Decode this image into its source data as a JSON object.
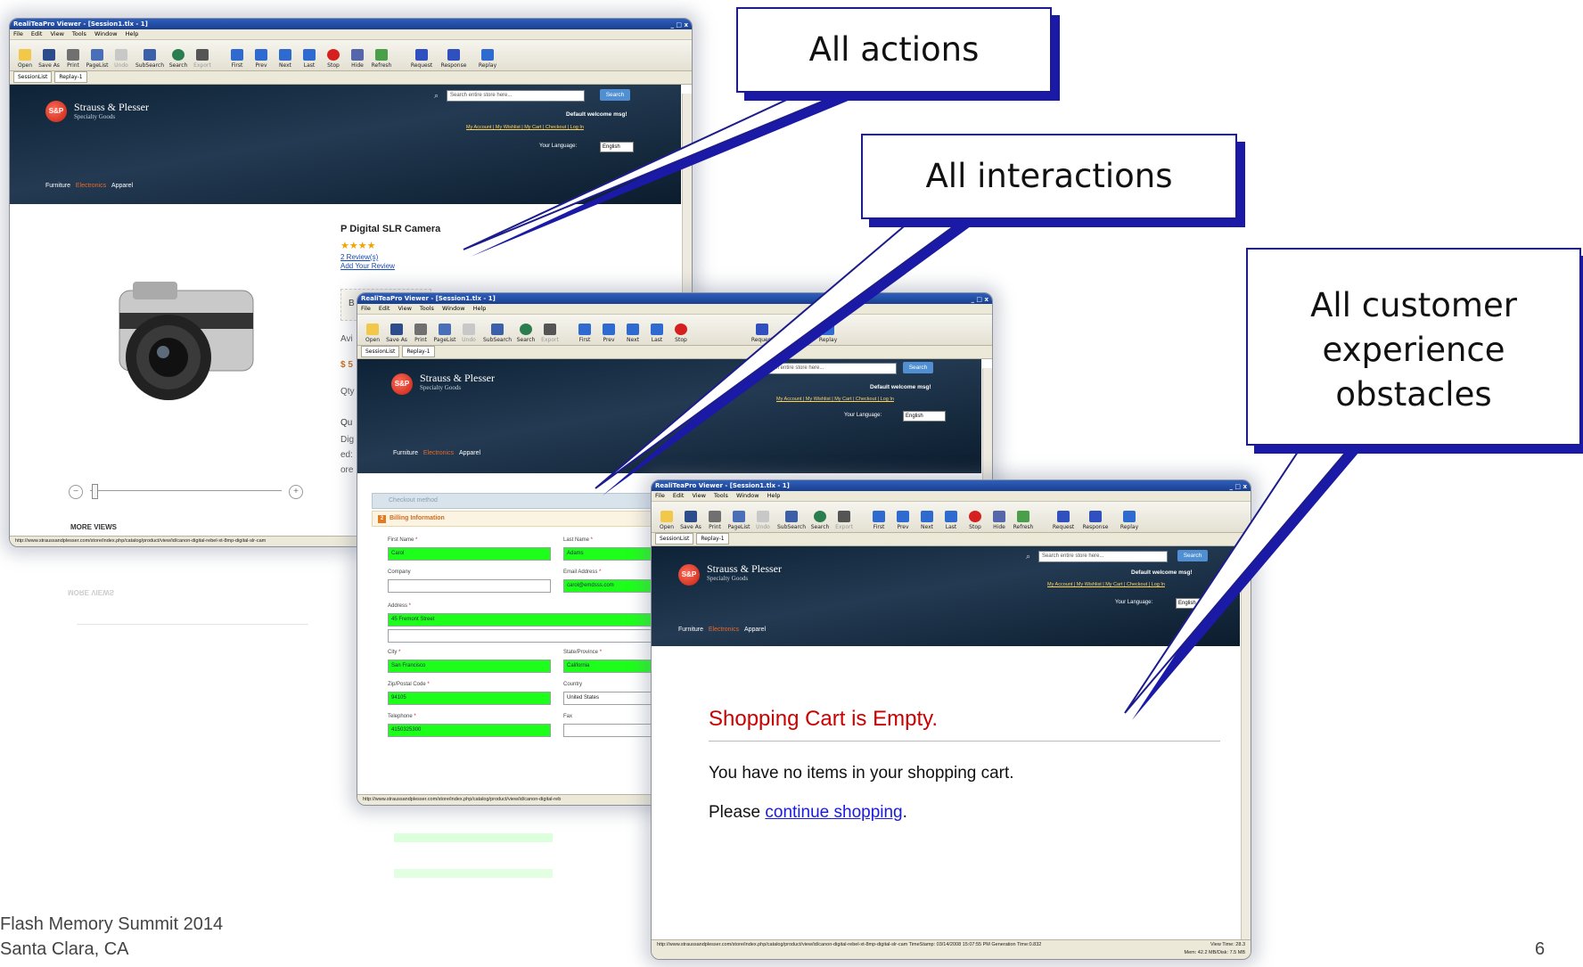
{
  "viewer": {
    "title": "RealiTeaPro Viewer - [Session1.tlx - 1]",
    "win_controls": "_ □ x",
    "menu": [
      "File",
      "Edit",
      "View",
      "Tools",
      "Window",
      "Help"
    ],
    "toolbar": [
      "Open",
      "Save As",
      "Print",
      "PageList",
      "Undo",
      "SubSearch",
      "Search",
      "Export",
      "First",
      "Prev",
      "Next",
      "Last",
      "Stop",
      "Hide",
      "Refresh",
      "Request",
      "Response",
      "Replay"
    ],
    "tabs": [
      "SessionList",
      "Replay-1"
    ]
  },
  "store": {
    "name": "Strauss & Plesser",
    "tagline": "Specialty Goods",
    "search_placeholder": "Search entire store here...",
    "search_button": "Search",
    "welcome": "Default welcome msg!",
    "links": "My Account | My Wishlist | My Cart | Checkout | Log In",
    "language_label": "Your Language:",
    "language_value": "English",
    "nav": [
      "Furniture",
      "Electronics",
      "Apparel"
    ]
  },
  "window1": {
    "product_title": "P Digital SLR Camera",
    "stars": "★★★★",
    "reviews": "2 Review(s)",
    "add_review": "Add Your Review",
    "more_views": "MORE VIEWS",
    "side_letters": [
      "B",
      "Avi",
      "$ 5",
      "Qty",
      "Qu",
      "Dig",
      "ed:",
      "ore"
    ],
    "url": "http://www.straussandplesser.com/store/index.php/catalog/product/view/id/canon-digital-rebel-xt-8mp-digital-slr-cam"
  },
  "window2": {
    "checkout_method": "Checkout method",
    "billing_step": "2",
    "billing": "Billing Information",
    "fields": {
      "first_name_label": "First Name",
      "first_name": "Carol",
      "last_name_label": "Last Name",
      "last_name": "Adams",
      "company_label": "Company",
      "email_label": "Email Address",
      "email": "carol@emdsss.com",
      "address_label": "Address",
      "address": "45 Fremont Street",
      "city_label": "City",
      "city": "San Francisco",
      "state_label": "State/Province",
      "state": "California",
      "zip_label": "Zip/Postal Code",
      "zip": "94105",
      "country_label": "Country",
      "country": "United States",
      "telephone_label": "Telephone",
      "telephone": "4150325300",
      "fax_label": "Fax"
    },
    "url": "http://www.straussandplesser.com/store/index.php/catalog/product/view/id/canon-digital-reb"
  },
  "window3": {
    "heading": "Shopping Cart is Empty.",
    "message": "You have no items in your shopping cart.",
    "please": "Please",
    "continue_link": "continue shopping",
    "period": ".",
    "url": "http://www.straussandplesser.com/store/index.php/catalog/product/view/id/canon-digital-rebel-xt-8mp-digital-slr-cam  TimeStamp: 03/14/2008 15:07:55 PM  Generation Time:0.832",
    "view_time": "View Time: 28.3",
    "mem": "Mem: 42.2 MB/Disk: 7.5 MB"
  },
  "callouts": {
    "actions": "All actions",
    "interactions": "All interactions",
    "obstacles_line1": "All customer",
    "obstacles_line2": "experience",
    "obstacles_line3": "obstacles"
  },
  "footer": {
    "line1": "Flash Memory Summit 2014",
    "line2": "Santa Clara, CA",
    "page_number": "6"
  },
  "colors": {
    "callout_border": "#1c1c8c",
    "callout_shadow": "#1a1aa6",
    "field_valid": "#1dff1a",
    "error_heading": "#cc0000",
    "link": "#1a1ae6",
    "header_dark": "#0d2236"
  }
}
